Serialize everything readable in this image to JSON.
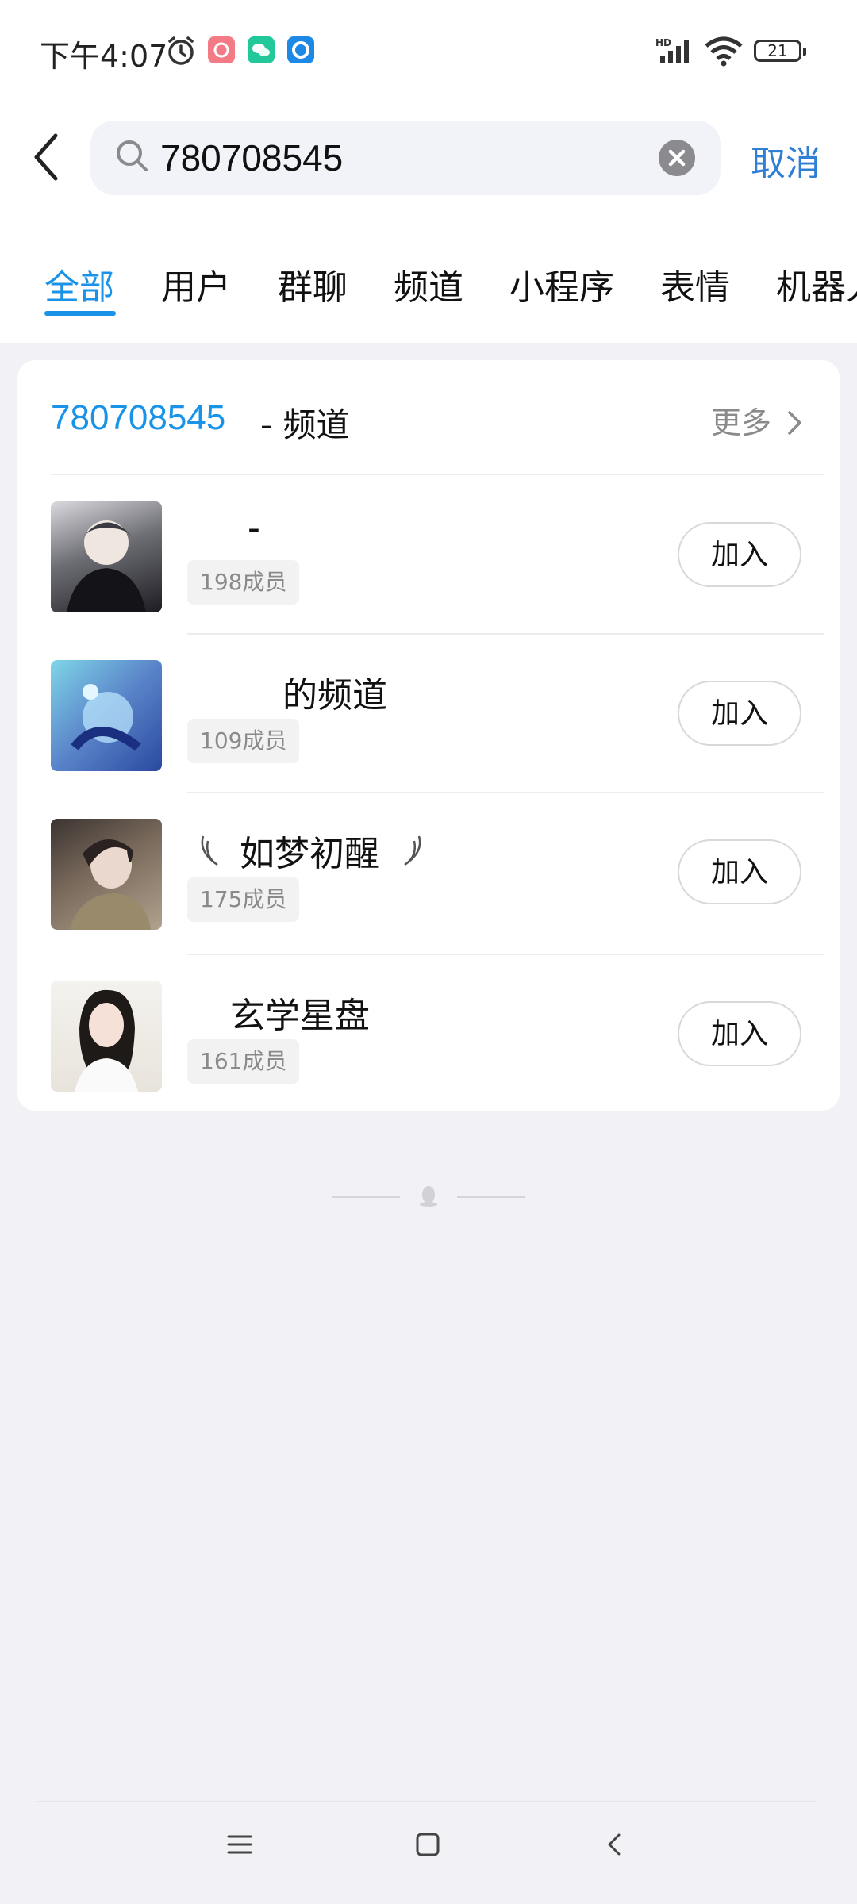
{
  "status_bar": {
    "time": "下午4:07",
    "icons": [
      "alarm-icon",
      "app-icon-pink",
      "wechat-icon",
      "app-icon-blue"
    ],
    "network": "HD",
    "battery": "21"
  },
  "search": {
    "query": "780708545",
    "cancel_label": "取消"
  },
  "tabs": [
    {
      "label": "全部",
      "active": true
    },
    {
      "label": "用户"
    },
    {
      "label": "群聊"
    },
    {
      "label": "频道"
    },
    {
      "label": "小程序"
    },
    {
      "label": "表情"
    },
    {
      "label": "机器人"
    }
  ],
  "result_section": {
    "title_id": "780708545",
    "title_suffix": "- 频道",
    "more_label": "更多"
  },
  "channels": [
    {
      "name": "-",
      "members": "198成员",
      "join_label": "加入"
    },
    {
      "name": "的频道",
      "members": "109成员",
      "join_label": "加入"
    },
    {
      "name": "如梦初醒",
      "members": "175成员",
      "join_label": "加入"
    },
    {
      "name": "玄学星盘",
      "members": "161成员",
      "join_label": "加入"
    }
  ],
  "colors": {
    "accent": "#1893e8",
    "cancel": "#2f7fd4",
    "page_background": "#f1f1f6"
  }
}
